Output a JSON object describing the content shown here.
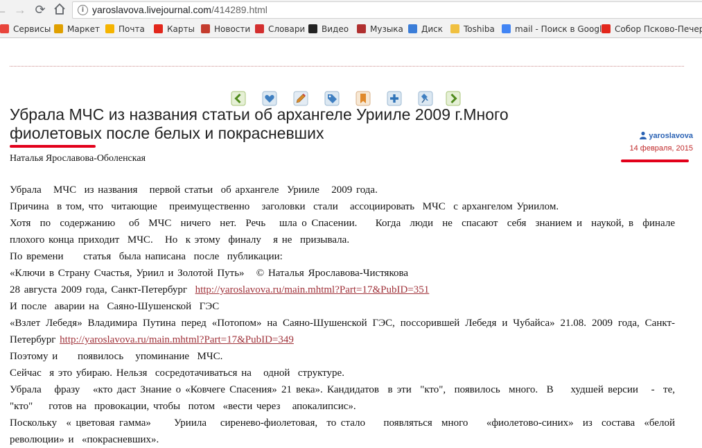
{
  "browser": {
    "url_host": "yaroslavova.livejournal.com",
    "url_path": "/414289.html"
  },
  "bookmarks": [
    {
      "label": "Сервисы",
      "icon": "apps-grid-icon",
      "color": "#e8453c"
    },
    {
      "label": "Маркет",
      "icon": "market-icon",
      "color": "#e0a000"
    },
    {
      "label": "Почта",
      "icon": "mail-icon",
      "color": "#f5b400"
    },
    {
      "label": "Карты",
      "icon": "map-pin-icon",
      "color": "#e2271c"
    },
    {
      "label": "Новости",
      "icon": "news-icon",
      "color": "#c43c2e"
    },
    {
      "label": "Словари",
      "icon": "dictionary-icon",
      "color": "#d32f2f"
    },
    {
      "label": "Видео",
      "icon": "video-play-icon",
      "color": "#222222"
    },
    {
      "label": "Музыка",
      "icon": "music-icon",
      "color": "#b03030"
    },
    {
      "label": "Диск",
      "icon": "disk-icon",
      "color": "#3b7dd8"
    },
    {
      "label": "Toshiba",
      "icon": "folder-icon",
      "color": "#f0c040"
    },
    {
      "label": "mail - Поиск в Google",
      "icon": "google-icon",
      "color": "#4285f4"
    },
    {
      "label": "Собор Псково-Печер",
      "icon": "yandex-icon",
      "color": "#e2271c"
    }
  ],
  "post": {
    "title": "Убрала МЧС из названия статьи об архангеле Уриилe 2009 г.Много фиолетовых после белых и покрасневших",
    "author_username": "yaroslavova",
    "date": "14 февраля, 2015",
    "byline": "Наталья  Ярославова-Оболенская",
    "paragraphs": [
      {
        "text": "Убрала   МЧС  из названия   первой статьи  об архангеле  Уриилe   2009 года."
      },
      {
        "text": "Причина  в том, что  читающие   преимущественно   заголовки  стали   ассоциировать  МЧС  с архангелом Уриилом."
      },
      {
        "text": "Хотя  по  содержанию   об  МЧС  ничего  нет.  Речь   шла о Спасении.    Когда  люди  не  спасают  себя  знанием и  наукой, в  финале  плохого конца приходит  МЧС.   Но  к этому  финалу   я не  призывала.",
        "justify": true
      },
      {
        "text": "По времени     статья  была написана  после  публикации:"
      },
      {
        "text": "«Ключи в Страну Счастья, Уриил и Золотой Путь»   © Наталья Ярославова-Чистякова"
      },
      {
        "text": "28 августа 2009 года, Санкт-Петербург  ",
        "link": "http://yaroslavova.ru/main.mhtml?Part=17&PubID=351"
      },
      {
        "text": "И после  аварии на  Саяно-Шушенской  ГЭС"
      },
      {
        "text": "«Взлет Лебедя» Владимира Путина перед «Потопом» на Саяно-Шушенской ГЭС, поссорившей Лебедя и Чубайса» 21.08. 2009 года, Санкт-Петербург ",
        "link": "http://yaroslavova.ru/main.mhtml?Part=17&PubID=349",
        "justify": true
      },
      {
        "text": "Поэтому и     появилось   упоминание  МЧС."
      },
      {
        "text": "Сейчас  я это убираю. Нельзя  сосредотачиваться на   одной  структуре."
      },
      {
        "text": "Убрала   фразу   «кто даст Знание о «Ковчеге Спасения» 21 века». Кандидатов  в эти  \"кто\",  появилось  много.  В    худшей версии   -  те, \"кто\"    готов на  провокации, чтобы  потом  «вести через   апокалипсис».",
        "justify": true
      },
      {
        "text": "Поскольку  « цветовая гамма»     Уриила   сиренево-фиолетовая,  то стало    появляться  много    «фиолетово-синих»  из  состава  «белой революции» и  «покрасневших».",
        "justify": true
      }
    ]
  }
}
